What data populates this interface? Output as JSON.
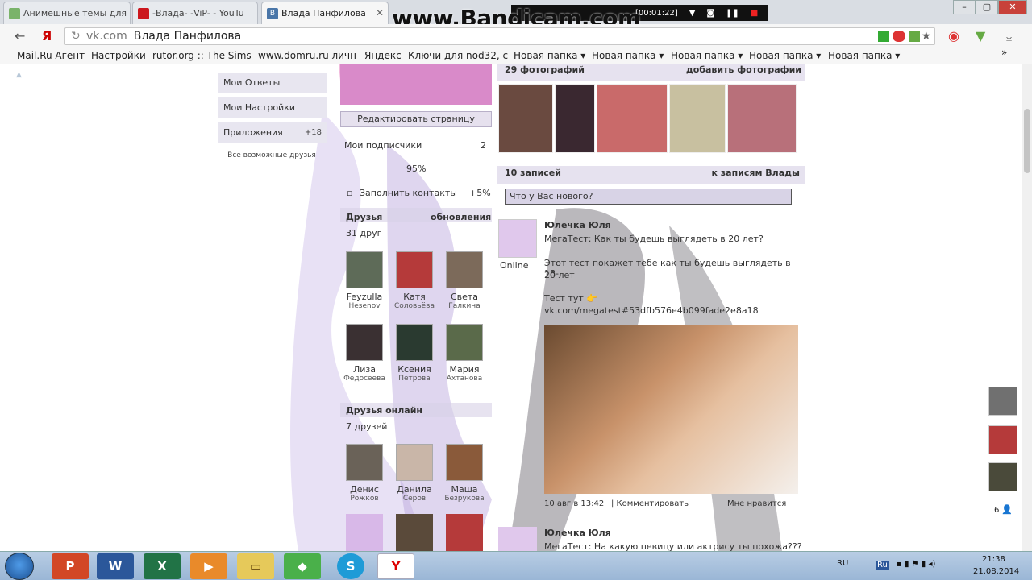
{
  "tabs": [
    {
      "title": "Анимешные темы для",
      "active": false
    },
    {
      "title": "-Влада- -ViP- - YouTu",
      "active": false
    },
    {
      "title": "Влада Панфилова",
      "active": true
    }
  ],
  "watermark": "www.Bandicam.com",
  "recorder": {
    "time": "[00:01:22]"
  },
  "address": {
    "host": "vk.com",
    "title": "Влада Панфилова"
  },
  "bookmarks": [
    "Mail.Ru Агент",
    "Настройки",
    "rutor.org :: The Sims",
    "www.domru.ru личн",
    "Яндекс",
    "Ключи для nod32, с",
    "Новая папка ▾",
    "Новая папка ▾",
    "Новая папка ▾",
    "Новая папка ▾",
    "Новая папка ▾",
    "»"
  ],
  "left_menu": {
    "answers": "Мои Ответы",
    "settings": "Мои Настройки",
    "apps": "Приложения",
    "apps_count": "+18",
    "all_friends": "Все возможные друзья"
  },
  "profile": {
    "edit_button": "Редактировать страницу",
    "subscribers_label": "Мои подписчики",
    "subscribers_count": "2",
    "percent": "95%",
    "fill_contacts": "Заполнить контакты",
    "fill_contacts_bonus": "+5%",
    "friends_title": "Друзья",
    "updates": "обновления",
    "friends_count": "31 друг",
    "friends": [
      {
        "first": "Feyzulla",
        "last": "Hesenov"
      },
      {
        "first": "Катя",
        "last": "Соловьёва"
      },
      {
        "first": "Света",
        "last": "Галкина"
      },
      {
        "first": "Лиза",
        "last": "Федосеева"
      },
      {
        "first": "Ксения",
        "last": "Петрова"
      },
      {
        "first": "Мария",
        "last": "Ахтанова"
      }
    ],
    "online_title": "Друзья онлайн",
    "online_count": "7 друзей",
    "online_friends": [
      {
        "first": "Денис",
        "last": "Рожков"
      },
      {
        "first": "Данила",
        "last": "Серов"
      },
      {
        "first": "Маша",
        "last": "Безрукова"
      }
    ]
  },
  "photos": {
    "count": "29 фотографий",
    "add": "добавить фотографии"
  },
  "wall": {
    "count": "10 записей",
    "link": "к записям Влады",
    "input_placeholder": "Что у Вас нового?",
    "post1": {
      "author": "Юлечка Юля",
      "online": "Online",
      "line1": "МегаТест: Как ты будешь выглядеть в 20 лет?",
      "line2": "Этот тест покажет тебе как ты будешь выглядеть в 18-",
      "line3": "20 лет",
      "line4": "Тест тут 👉",
      "line5": "vk.com/megatest#53dfb576e4b099fade2e8a18",
      "date": "10 авг в 13:42",
      "comment": "| Комментировать",
      "like": "Мне нравится"
    },
    "post2": {
      "author": "Юлечка Юля",
      "line1": "МегаТест: На какую певицу или актрису ты похожа???"
    }
  },
  "side_counter": "6",
  "tray": {
    "lang": "RU",
    "time": "21:38",
    "date": "21.08.2014"
  },
  "colors": {
    "vk_tab": "#4a76a8",
    "youtube": "#cc181e",
    "lilac": "#e8e6f0"
  }
}
